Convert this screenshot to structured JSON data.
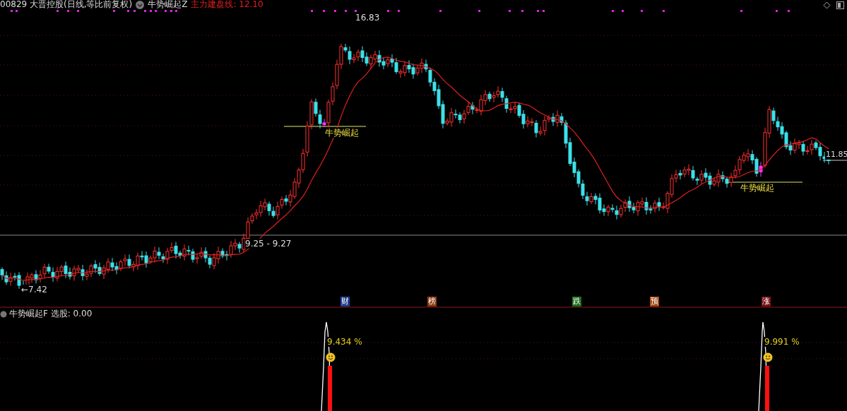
{
  "header": {
    "title": "00829 大晋控股(日线,等比前复权)",
    "indicator": "牛势崛起Z",
    "line_label": "主力建盘线: 12.10"
  },
  "price_labels": [
    {
      "kind": "high",
      "text": "16.83"
    },
    {
      "kind": "low",
      "text": "←7.42"
    },
    {
      "kind": "range",
      "text": "9.25 - 9.27"
    },
    {
      "kind": "last",
      "text": "11.85"
    }
  ],
  "signals": [
    {
      "text": "牛势崛起"
    },
    {
      "text": "牛势崛起"
    }
  ],
  "events": [
    {
      "text": "财",
      "color": "#1f3f8f"
    },
    {
      "text": "榜",
      "color": "#8a3a10"
    },
    {
      "text": "跌",
      "color": "#1d6b1d"
    },
    {
      "text": "预",
      "color": "#a04a14"
    },
    {
      "text": "涨",
      "color": "#7a1010"
    }
  ],
  "sub_panel": {
    "title": "牛势崛起F 选股: 0.00",
    "readings": [
      "9.434 %",
      "9.991 %"
    ]
  }
}
